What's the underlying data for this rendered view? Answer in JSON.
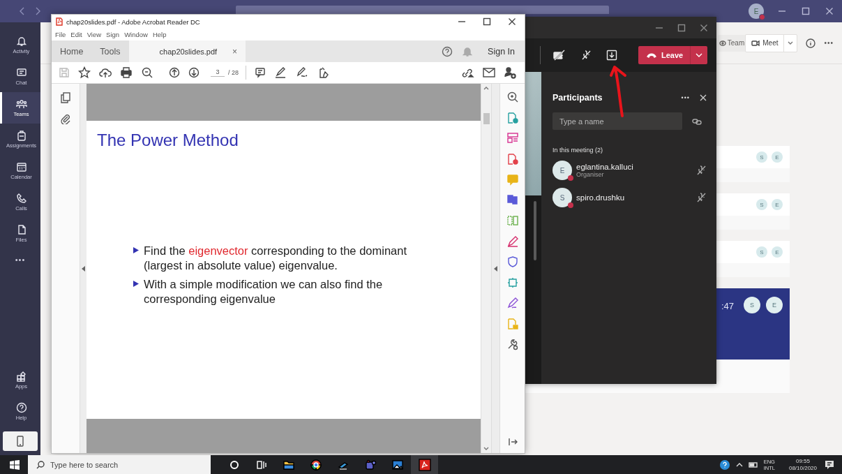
{
  "teams": {
    "rail": [
      {
        "label": "Activity",
        "selected": false
      },
      {
        "label": "Chat",
        "selected": false
      },
      {
        "label": "Teams",
        "selected": true
      },
      {
        "label": "Assignments",
        "selected": false
      },
      {
        "label": "Calendar",
        "selected": false
      },
      {
        "label": "Calls",
        "selected": false
      },
      {
        "label": "Files",
        "selected": false
      }
    ],
    "rail_more": "•••",
    "rail_bottom": [
      {
        "label": "Apps",
        "selected": false
      },
      {
        "label": "Help",
        "selected": false
      }
    ],
    "user": {
      "initial": "E"
    },
    "header": {
      "team_button": "Team",
      "meet_button": "Meet",
      "more": "•••"
    },
    "cards": [
      {
        "avatars": [
          "S",
          "E"
        ]
      },
      {
        "avatars": [
          "S",
          "E"
        ]
      },
      {
        "avatars": [
          "S",
          "E"
        ]
      }
    ],
    "active_card": {
      "time": ":47",
      "avatars": [
        "S",
        "E"
      ]
    }
  },
  "acrobat": {
    "title": "chap20slides.pdf - Adobe Acrobat Reader DC",
    "menu": [
      "File",
      "Edit",
      "View",
      "Sign",
      "Window",
      "Help"
    ],
    "tabs": [
      {
        "label": "Home",
        "selected": false
      },
      {
        "label": "Tools",
        "selected": false
      },
      {
        "label": "chap20slides.pdf",
        "selected": true
      }
    ],
    "tab_close": "×",
    "sign_in": "Sign In",
    "page_current": "3",
    "page_total": "/ 28",
    "slide": {
      "title": "The Power Method",
      "bullets": [
        {
          "parts": [
            {
              "kind": "plain",
              "text": "Find the "
            },
            {
              "kind": "alert",
              "text": "eigenvector"
            },
            {
              "kind": "plain",
              "text": " corresponding to the dominant (largest in absolute value) eigenvalue."
            }
          ]
        },
        {
          "parts": [
            {
              "kind": "plain",
              "text": "With a simple modification we can also find the corresponding eigenvalue"
            }
          ]
        }
      ]
    }
  },
  "meeting": {
    "leave_button": "Leave",
    "participants_title": "Participants",
    "more": "•••",
    "search_placeholder": "Type a name",
    "section": "In this meeting (2)",
    "participants": [
      {
        "initial": "E",
        "name": "eglantina.kalluci",
        "role": "Organiser"
      },
      {
        "initial": "S",
        "name": "spiro.drushku"
      }
    ]
  },
  "taskbar": {
    "search_placeholder": "Type here to search",
    "language": "ENG",
    "layout": "INTL",
    "time": "09:55",
    "date": "08/10/2020"
  }
}
